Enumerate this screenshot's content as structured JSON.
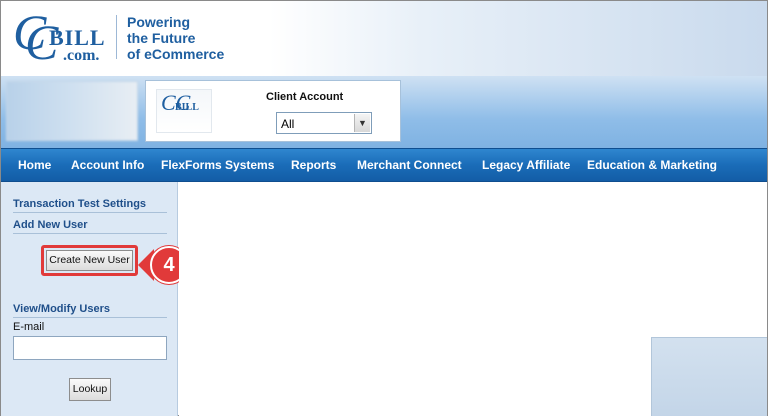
{
  "header": {
    "logo_text": {
      "c_letter": "C",
      "bill": "BILL",
      "dotcom": ".com."
    },
    "tagline": [
      "Powering",
      "the Future",
      "of eCommerce"
    ]
  },
  "account": {
    "mini_logo": {
      "cc": "CC",
      "bill": "BILL"
    },
    "client_label": "Client Account",
    "client_select_value": "All"
  },
  "nav": {
    "items": [
      "Home",
      "Account Info",
      "FlexForms Systems",
      "Reports",
      "Merchant Connect",
      "Legacy Affiliate",
      "Education & Marketing"
    ]
  },
  "sidebar": {
    "transaction_settings": "Transaction Test Settings",
    "add_new_user": "Add New User",
    "create_button": "Create New User",
    "view_modify_users": "View/Modify Users",
    "email_label": "E-mail",
    "email_value": "",
    "lookup_button": "Lookup"
  },
  "callout": {
    "number": "4"
  },
  "colors": {
    "brand_blue": "#1f5fa0",
    "nav_blue": "#1a6cb8",
    "callout_red": "#e13a3a",
    "sidebar_bg": "#dce8f5"
  }
}
